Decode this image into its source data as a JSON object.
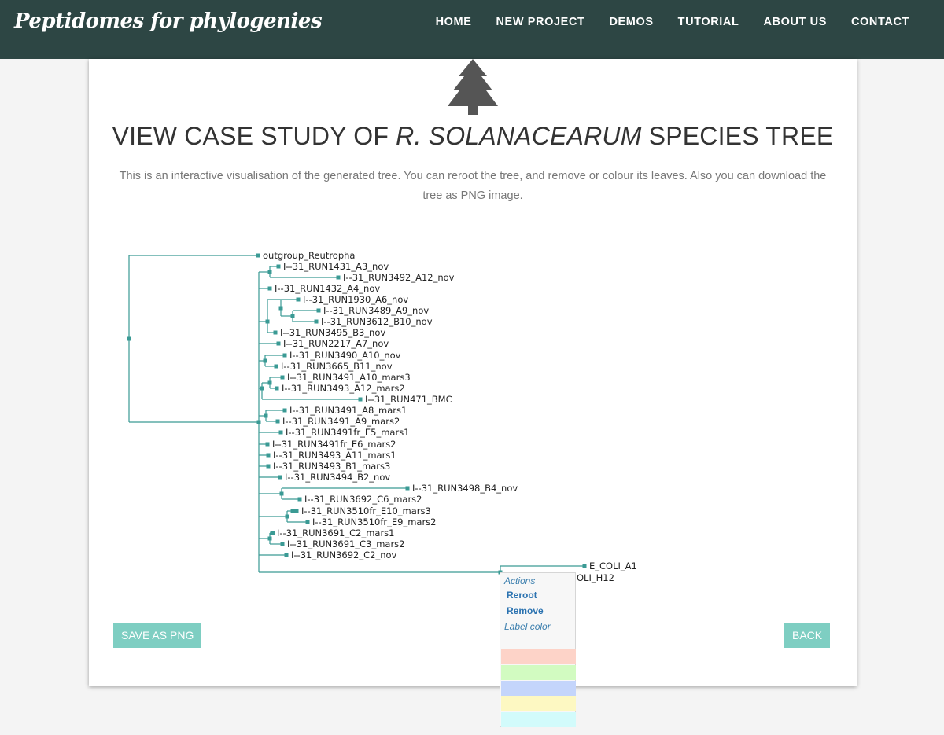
{
  "nav": {
    "brand": "Peptidomes for phylogenies",
    "items": [
      "HOME",
      "NEW PROJECT",
      "DEMOS",
      "TUTORIAL",
      "ABOUT US",
      "CONTACT"
    ]
  },
  "page": {
    "title_prefix": "VIEW CASE STUDY OF ",
    "title_italic": "R. SOLANACEARUM",
    "title_suffix": " SPECIES TREE",
    "description": "This is an interactive visualisation of the generated tree. You can reroot the tree, and remove or colour its leaves. Also you can download the tree as PNG image."
  },
  "tree": {
    "leaves": [
      "outgroup_Reutropha",
      "I--31_RUN1431_A3_nov",
      "I--31_RUN3492_A12_nov",
      "I--31_RUN1432_A4_nov",
      "I--31_RUN1930_A6_nov",
      "I--31_RUN3489_A9_nov",
      "I--31_RUN3612_B10_nov",
      "I--31_RUN3495_B3_nov",
      "I--31_RUN2217_A7_nov",
      "I--31_RUN3490_A10_nov",
      "I--31_RUN3665_B11_nov",
      "I--31_RUN3491_A10_mars3",
      "I--31_RUN3493_A12_mars2",
      "I--31_RUN471_BMC",
      "I--31_RUN3491_A8_mars1",
      "I--31_RUN3491_A9_mars2",
      "I--31_RUN3491fr_E5_mars1",
      "I--31_RUN3491fr_E6_mars2",
      "I--31_RUN3493_A11_mars1",
      "I--31_RUN3493_B1_mars3",
      "I--31_RUN3494_B2_nov",
      "I--31_RUN3498_B4_nov",
      "I--31_RUN3692_C6_mars2",
      "I--31_RUN3510fr_E10_mars3",
      "I--31_RUN3510fr_E9_mars2",
      "I--31_RUN3691_C2_mars1",
      "I--31_RUN3691_C3_mars2",
      "I--31_RUN3692_C2_nov",
      "E_COLI_A1",
      "OLI_H12"
    ]
  },
  "buttons": {
    "save": "SAVE AS PNG",
    "back": "BACK"
  },
  "context_menu": {
    "header": "Actions",
    "reroot": "Reroot",
    "remove": "Remove",
    "label_color": "Label color",
    "swatches": [
      "#fdd3c8",
      "#d2fbc1",
      "#c4d5fb",
      "#fdf8c2",
      "#d2fbfb"
    ]
  },
  "colors": {
    "navbar": "#2d4644",
    "accent": "#7ecec2",
    "tree_line": "#3a9a94",
    "link": "#2a72b0"
  }
}
